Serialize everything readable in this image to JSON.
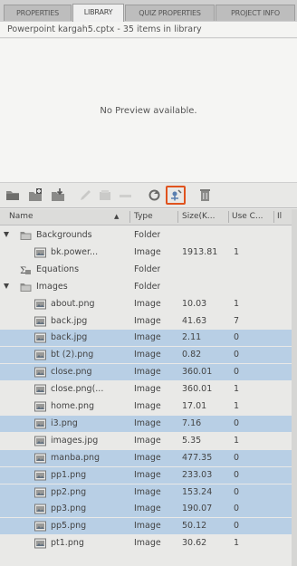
{
  "tabs": [
    {
      "label": "PROPERTIES",
      "active": false
    },
    {
      "label": "LIBRARY",
      "active": true
    },
    {
      "label": "QUIZ PROPERTIES",
      "active": false
    },
    {
      "label": "PROJECT INFO",
      "active": false
    }
  ],
  "library_path": "Powerpoint kargah5.cptx - 35 items in library",
  "preview": {
    "message": "No Preview available."
  },
  "toolbar": {
    "icons": [
      "open-library-icon",
      "new-folder-icon",
      "import-icon",
      "edit-icon",
      "edit-with-icon",
      "link-icon",
      "update-icon",
      "usage-icon",
      "delete-icon"
    ],
    "highlight_color": "#e0531e"
  },
  "columns": {
    "name": "Name",
    "type": "Type",
    "size": "Size(K...",
    "use": "Use C...",
    "date": "Il"
  },
  "items": [
    {
      "name": "Backgrounds",
      "type": "Folder",
      "size": "",
      "use": "",
      "kind": "folder",
      "level": 0,
      "expanded": true,
      "selected": false
    },
    {
      "name": "bk.power...",
      "type": "Image",
      "size": "1913.81",
      "use": "1",
      "kind": "image",
      "level": 1,
      "selected": false
    },
    {
      "name": "Equations",
      "type": "Folder",
      "size": "",
      "use": "",
      "kind": "equation-folder",
      "level": 0,
      "selected": false
    },
    {
      "name": "Images",
      "type": "Folder",
      "size": "",
      "use": "",
      "kind": "folder",
      "level": 0,
      "expanded": true,
      "selected": false
    },
    {
      "name": "about.png",
      "type": "Image",
      "size": "10.03",
      "use": "1",
      "kind": "image",
      "level": 1,
      "selected": false
    },
    {
      "name": "back.jpg",
      "type": "Image",
      "size": "41.63",
      "use": "7",
      "kind": "image",
      "level": 1,
      "selected": false
    },
    {
      "name": "back.jpg",
      "type": "Image",
      "size": "2.11",
      "use": "0",
      "kind": "image",
      "level": 1,
      "selected": true
    },
    {
      "name": "bt (2).png",
      "type": "Image",
      "size": "0.82",
      "use": "0",
      "kind": "image",
      "level": 1,
      "selected": true
    },
    {
      "name": "close.png",
      "type": "Image",
      "size": "360.01",
      "use": "0",
      "kind": "image",
      "level": 1,
      "selected": true
    },
    {
      "name": "close.png(...",
      "type": "Image",
      "size": "360.01",
      "use": "1",
      "kind": "image",
      "level": 1,
      "selected": false
    },
    {
      "name": "home.png",
      "type": "Image",
      "size": "17.01",
      "use": "1",
      "kind": "image",
      "level": 1,
      "selected": false
    },
    {
      "name": "i3.png",
      "type": "Image",
      "size": "7.16",
      "use": "0",
      "kind": "image",
      "level": 1,
      "selected": true
    },
    {
      "name": "images.jpg",
      "type": "Image",
      "size": "5.35",
      "use": "1",
      "kind": "image",
      "level": 1,
      "selected": false
    },
    {
      "name": "manba.png",
      "type": "Image",
      "size": "477.35",
      "use": "0",
      "kind": "image",
      "level": 1,
      "selected": true
    },
    {
      "name": "pp1.png",
      "type": "Image",
      "size": "233.03",
      "use": "0",
      "kind": "image",
      "level": 1,
      "selected": true
    },
    {
      "name": "pp2.png",
      "type": "Image",
      "size": "153.24",
      "use": "0",
      "kind": "image",
      "level": 1,
      "selected": true
    },
    {
      "name": "pp3.png",
      "type": "Image",
      "size": "190.07",
      "use": "0",
      "kind": "image",
      "level": 1,
      "selected": true
    },
    {
      "name": "pp5.png",
      "type": "Image",
      "size": "50.12",
      "use": "0",
      "kind": "image",
      "level": 1,
      "selected": true
    },
    {
      "name": "pt1.png",
      "type": "Image",
      "size": "30.62",
      "use": "1",
      "kind": "image",
      "level": 1,
      "selected": false
    }
  ]
}
